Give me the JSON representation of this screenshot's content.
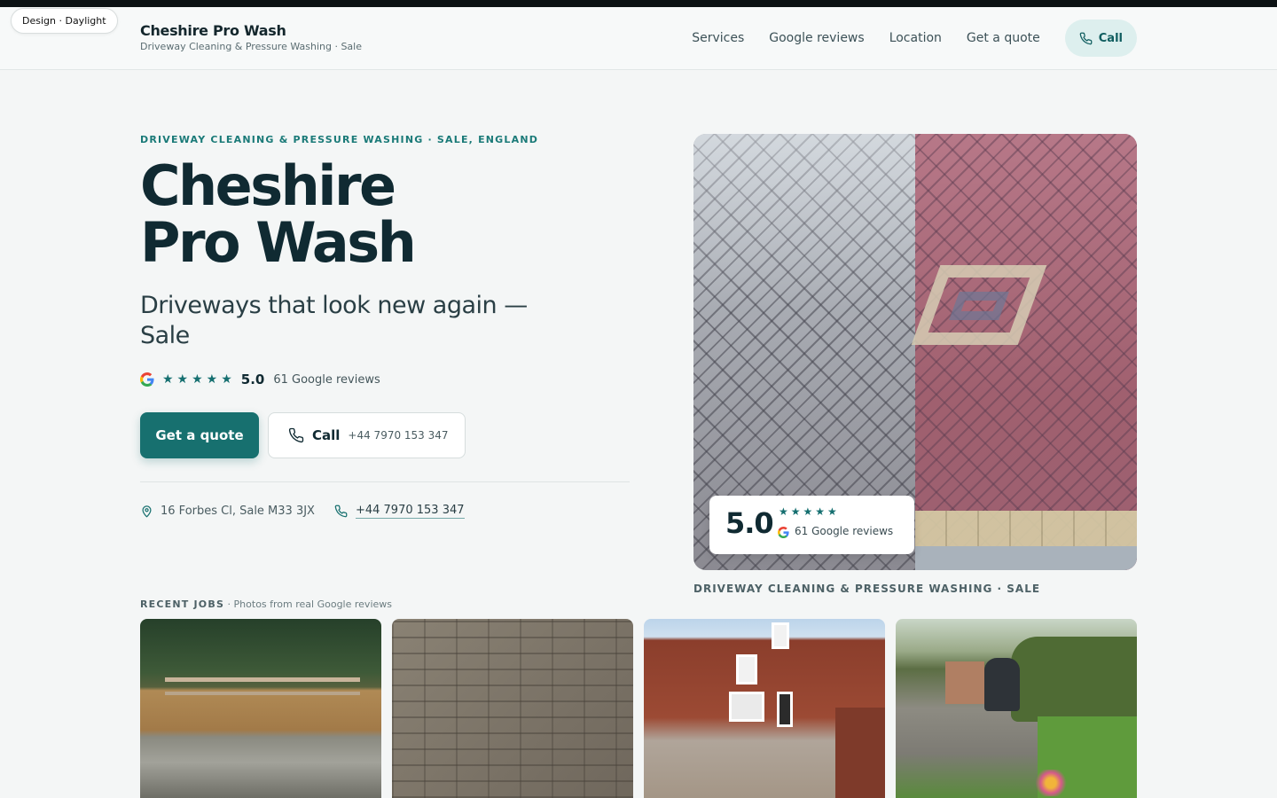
{
  "design_badge": "Design · Daylight",
  "brand": {
    "name": "Cheshire Pro Wash",
    "subtitle": "Driveway Cleaning & Pressure Washing · Sale"
  },
  "nav": {
    "links": [
      "Services",
      "Google reviews",
      "Location",
      "Get a quote"
    ],
    "call_label": "Call"
  },
  "hero": {
    "eyebrow": "DRIVEWAY CLEANING & PRESSURE WASHING · SALE, ENGLAND",
    "title_line1": "Cheshire",
    "title_line2": "Pro Wash",
    "subtitle": "Driveways that look new again — Sale",
    "rating": {
      "stars": "★★★★★",
      "value": "5.0",
      "count": "61 Google reviews"
    },
    "quote_button": "Get a quote",
    "call_button": {
      "label": "Call",
      "number": "+44 7970 153 347"
    },
    "address": "16 Forbes Cl, Sale M33 3JX",
    "phone": "+44 7970 153 347"
  },
  "photo_card": {
    "value": "5.0",
    "stars": "★★★★★",
    "count": "61 Google reviews",
    "caption": "DRIVEWAY CLEANING & PRESSURE WASHING · SALE"
  },
  "jobs": {
    "title": "RECENT JOBS",
    "subtitle": " · Photos from real Google reviews"
  },
  "colors": {
    "accent": "#17706f",
    "accent_soft": "#ddefee",
    "text_dark": "#102a32",
    "background": "#f4f6f6"
  },
  "icons": [
    "phone-icon",
    "location-pin-icon",
    "google-logo-icon",
    "star-icon"
  ]
}
